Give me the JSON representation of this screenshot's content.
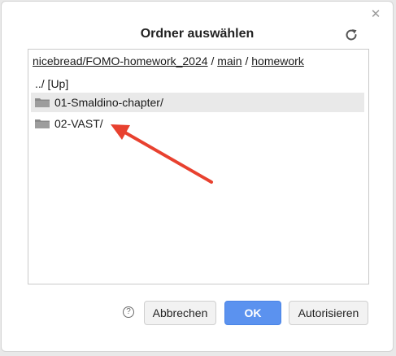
{
  "dialog": {
    "title": "Ordner auswählen",
    "close_icon": "close-icon",
    "refresh_icon": "refresh-icon"
  },
  "breadcrumb": {
    "path": "nicebread/FOMO-homework_2024",
    "sep1": "/",
    "branch": "main",
    "sep2": "/",
    "folder": "homework"
  },
  "listing": {
    "up_label": "../ [Up]",
    "items": [
      {
        "label": "01-Smaldino-chapter/",
        "icon": "folder-icon",
        "selected": true
      },
      {
        "label": "02-VAST/",
        "icon": "folder-icon",
        "selected": false
      }
    ]
  },
  "buttons": {
    "help_label": "?",
    "cancel_label": "Abbrechen",
    "ok_label": "OK",
    "authorize_label": "Autorisieren"
  },
  "colors": {
    "primary": "#5b92ef",
    "annotation_arrow": "#e8412f",
    "selected_row": "#e9e9e9"
  }
}
